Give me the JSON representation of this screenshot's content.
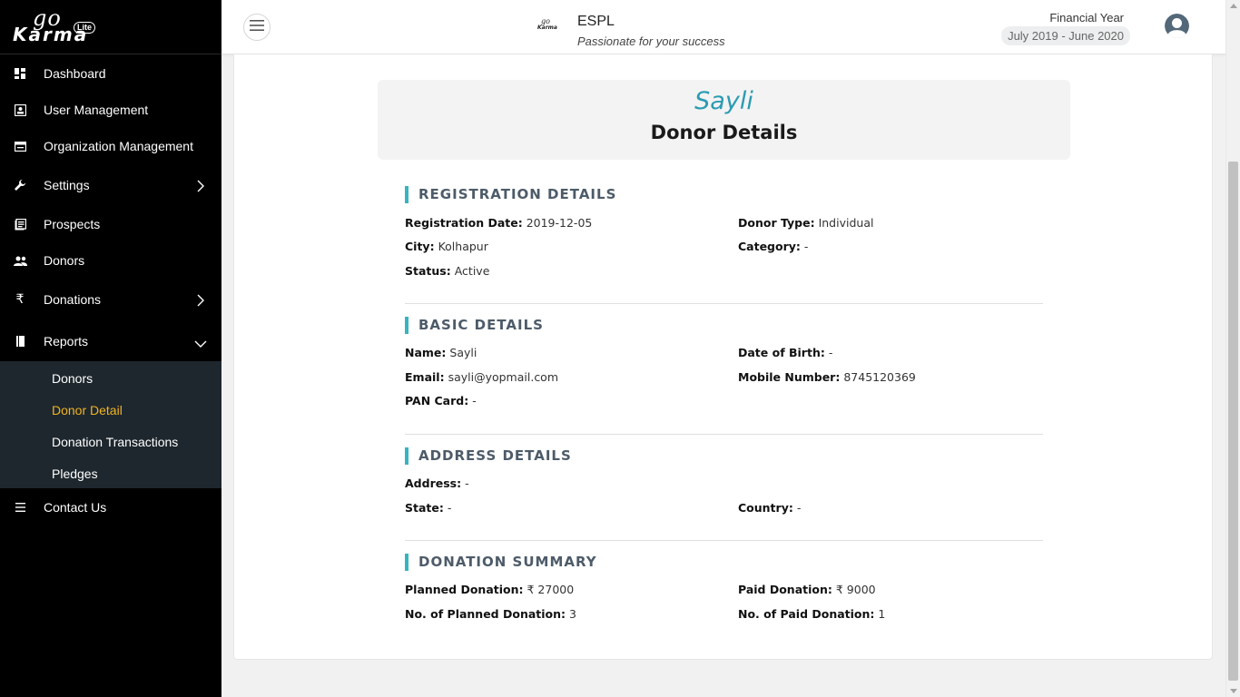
{
  "sidebar": {
    "logo": {
      "go": "go",
      "karma": "Karma",
      "lite": "Lite"
    },
    "items": [
      {
        "label": "Dashboard",
        "icon": "dashboard-icon"
      },
      {
        "label": "User Management",
        "icon": "user-card-icon"
      },
      {
        "label": "Organization Management",
        "icon": "organization-icon"
      },
      {
        "label": "Settings",
        "icon": "wrench-icon"
      },
      {
        "label": "Prospects",
        "icon": "prospects-icon"
      },
      {
        "label": "Donors",
        "icon": "people-icon"
      },
      {
        "label": "Donations",
        "icon": "rupee-icon"
      },
      {
        "label": "Reports",
        "icon": "book-icon"
      },
      {
        "label": "Contact Us",
        "icon": "list-icon"
      }
    ],
    "reports_submenu": [
      {
        "label": "Donors",
        "active": false
      },
      {
        "label": "Donor Detail",
        "active": true
      },
      {
        "label": "Donation Transactions",
        "active": false
      },
      {
        "label": "Pledges",
        "active": false
      }
    ],
    "active_color": "#f0b323"
  },
  "header": {
    "org_name": "ESPL",
    "org_tagline": "Passionate for your success",
    "financial_year_label": "Financial Year",
    "financial_year_value": "July 2019 - June 2020"
  },
  "donor": {
    "name": "Sayli",
    "page_title": "Donor Details"
  },
  "sections": {
    "registration": {
      "title": "REGISTRATION DETAILS",
      "registration_date": {
        "label": "Registration Date:",
        "value": "2019-12-05"
      },
      "donor_type": {
        "label": "Donor Type:",
        "value": "Individual"
      },
      "city": {
        "label": "City:",
        "value": "Kolhapur"
      },
      "category": {
        "label": "Category:",
        "value": "-"
      },
      "status": {
        "label": "Status:",
        "value": "Active"
      }
    },
    "basic": {
      "title": "BASIC DETAILS",
      "name": {
        "label": "Name:",
        "value": "Sayli"
      },
      "dob": {
        "label": "Date of Birth:",
        "value": "-"
      },
      "email": {
        "label": "Email:",
        "value": "sayli@yopmail.com"
      },
      "mobile": {
        "label": "Mobile Number:",
        "value": "8745120369"
      },
      "pan": {
        "label": "PAN Card:",
        "value": "-"
      }
    },
    "address": {
      "title": "ADDRESS DETAILS",
      "address": {
        "label": "Address:",
        "value": "-"
      },
      "state": {
        "label": "State:",
        "value": "-"
      },
      "country": {
        "label": "Country:",
        "value": "-"
      }
    },
    "donation": {
      "title": "DONATION SUMMARY",
      "planned": {
        "label": "Planned Donation:",
        "value": "₹ 27000"
      },
      "paid": {
        "label": "Paid Donation:",
        "value": "₹ 9000"
      },
      "planned_count": {
        "label": "No. of Planned Donation:",
        "value": "3"
      },
      "paid_count": {
        "label": "No. of Paid Donation:",
        "value": "1"
      }
    }
  },
  "colors": {
    "accent": "#2b9bb3",
    "section_bar": "#36b4c0",
    "sidebar_bg": "#000000",
    "submenu_bg": "#1e272e"
  }
}
